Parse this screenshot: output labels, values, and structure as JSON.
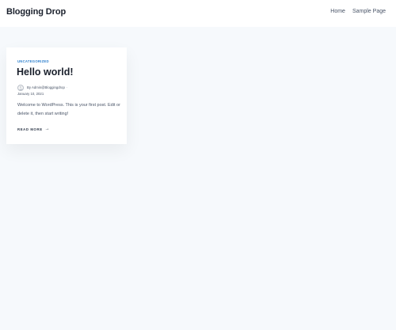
{
  "header": {
    "site_title": "Blogging Drop",
    "nav": [
      {
        "label": "Home"
      },
      {
        "label": "Sample Page"
      }
    ]
  },
  "post": {
    "category": "UNCATEGORIZED",
    "title": "Hello world!",
    "author": "By Admin@Bloggingdrop",
    "date": "January 10, 2021",
    "excerpt": "Welcome to WordPress. This is your first post. Edit or delete it, then start writing!",
    "read_more": "READ MORE",
    "arrow": "→"
  },
  "colors": {
    "page_background": "#f6f9fc",
    "accent": "#3182ce",
    "heading": "#1a202c",
    "body_text": "#4a5568"
  }
}
